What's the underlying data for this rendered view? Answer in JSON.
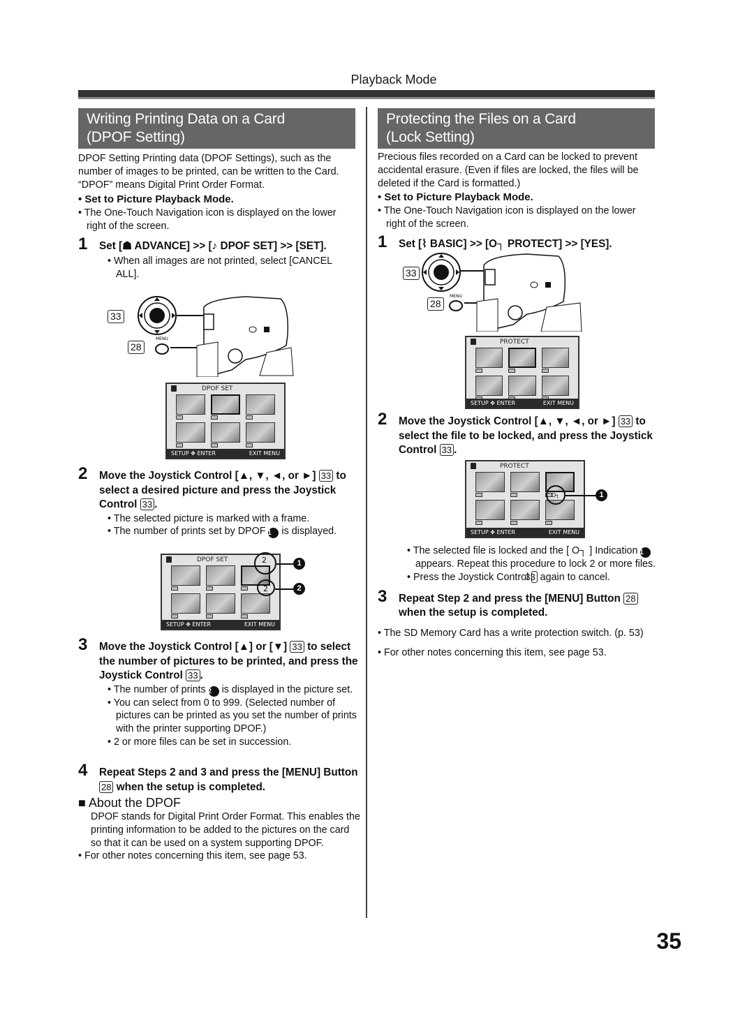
{
  "header": {
    "section": "Playback Mode"
  },
  "left": {
    "title_line1": "Writing Printing Data on a Card",
    "title_line2": "(DPOF Setting)",
    "intro": "DPOF Setting Printing data (DPOF Settings), such as the number of images to be printed, can be written to the Card. “DPOF” means Digital Print Order Format.",
    "prereq": "Set to Picture Playback Mode.",
    "note": "The One-Touch Navigation icon is displayed on the lower right of the screen.",
    "step1": {
      "num": "1",
      "text_a": "Set [",
      "icon_advance": "☗",
      "text_b": " ADVANCE] >> [",
      "icon_dpof": "♪",
      "text_c": " DPOF SET] >> [SET].",
      "bullets": [
        "When all images are not printed, select [CANCEL ALL]."
      ]
    },
    "illustration": {
      "ref_joystick": "33",
      "ref_menu": "28",
      "menu_label": "MENU",
      "screen_title": "DPOF  SET",
      "screen_footer_left": "SETUP ✥ ENTER",
      "screen_footer_right": "EXIT MENU"
    },
    "step2": {
      "num": "2",
      "line1": "Move the Joystick Control [▲, ▼, ◄, or ►]",
      "ref1": "33",
      "line2": " to select a desired picture and press the Joystick Control ",
      "ref2": "33",
      "end": ".",
      "bullets": [
        "The selected picture is marked with a frame."
      ],
      "bullet2_a": "The number of prints set by DPOF ",
      "bullet2_marker": "1",
      "bullet2_b": " is displayed.",
      "screen_count_top": "2",
      "screen_count_bottom": "2",
      "callout1": "1",
      "callout2": "2"
    },
    "step3": {
      "num": "3",
      "line_a": "Move the Joystick Control [▲] or [▼] ",
      "ref1": "33",
      "line_b": " to select the number of pictures to be printed, and press the Joystick Control ",
      "ref2": "33",
      "end": ".",
      "bullet1_a": "The number of prints ",
      "bullet1_marker": "2",
      "bullet1_b": " is displayed in the picture set.",
      "bullets": [
        "You can select from 0 to 999. (Selected number of pictures can be printed as you set the number of prints with the printer supporting DPOF.)",
        "2 or more files can be set in succession."
      ]
    },
    "step4": {
      "num": "4",
      "line_a": "Repeat Steps 2 and 3 and press the [MENU] Button ",
      "ref": "28",
      "line_b": " when the setup is completed."
    },
    "about": {
      "heading": "■ About the DPOF",
      "text": "DPOF stands for Digital Print Order Format. This enables the printing information to be added to the pictures on the card so that it can be used on a system supporting DPOF.",
      "note": "For other notes concerning this item, see page 53."
    }
  },
  "right": {
    "title_line1": "Protecting the Files on a Card",
    "title_line2": "(Lock Setting)",
    "intro": "Precious files recorded on a Card can be locked to prevent accidental erasure. (Even if files are locked, the files will be deleted if the Card is formatted.)",
    "prereq": "Set to Picture Playback Mode.",
    "note": "The One-Touch Navigation icon is displayed on the lower right of the screen.",
    "step1": {
      "num": "1",
      "text_a": "Set [",
      "icon_basic": "⌇",
      "text_b": " BASIC] >> [",
      "icon_protect": "O┐",
      "text_c": " PROTECT] >> [YES]."
    },
    "illustration": {
      "ref_joystick": "33",
      "ref_menu": "28",
      "menu_label": "MENU",
      "screen_title": "PROTECT",
      "screen_footer_left": "SETUP ✥ ENTER",
      "screen_footer_right": "EXIT MENU"
    },
    "step2": {
      "num": "2",
      "line1": "Move the Joystick Control [▲, ▼, ◄, or ►]",
      "ref1": "33",
      "line2": " to select the file to be locked, and press the Joystick Control ",
      "ref2": "33",
      "end": ".",
      "callout1": "1",
      "bullet1_a": "The selected file is locked and the [ O┐ ] Indication ",
      "bullet1_marker": "1",
      "bullet1_b": " appears. Repeat this procedure to lock 2 or more files.",
      "bullet2_a": "Press the Joystick Control ",
      "bullet2_ref": "33",
      "bullet2_b": " again to cancel."
    },
    "step3": {
      "num": "3",
      "line_a": "Repeat Step 2 and press the [MENU] Button ",
      "ref": "28",
      "line_b": " when the setup is completed."
    },
    "notes": [
      "The SD Memory Card has a write protection switch. (p. 53)",
      "For other notes concerning this item, see page 53."
    ]
  },
  "footer": {
    "page_number": "35"
  }
}
